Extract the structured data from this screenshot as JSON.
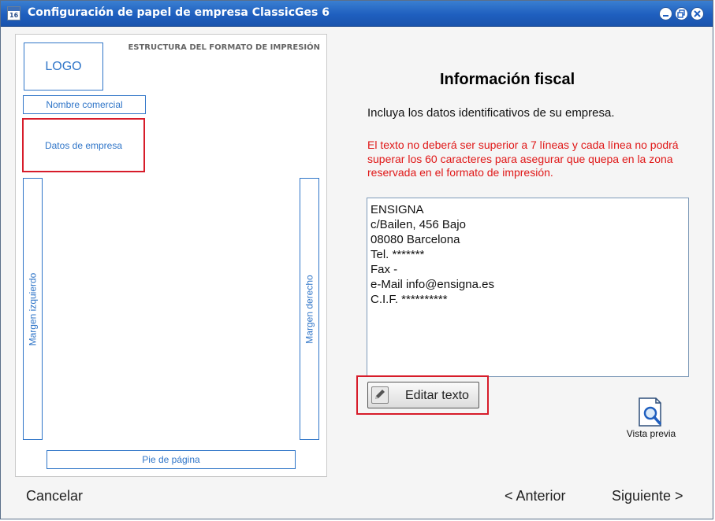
{
  "window": {
    "title": "Configuración de papel de empresa ClassicGes 6",
    "app_icon_text": "16"
  },
  "preview": {
    "structure_label": "ESTRUCTURA DEL FORMATO DE IMPRESIÓN",
    "logo": "LOGO",
    "trade_name": "Nombre comercial",
    "company_data": "Datos de empresa",
    "left_margin": "Margen izquierdo",
    "right_margin": "Margen derecho",
    "footer": "Pie de página"
  },
  "main": {
    "heading": "Información fiscal",
    "intro": "Incluya los datos identificativos de su empresa.",
    "warning": "El texto no deberá ser superior a 7 líneas y cada línea no podrá superar los 60 caracteres para asegurar que quepa en la zona reservada en el formato de impresión.",
    "fiscal_lines": [
      "ENSIGNA",
      "c/Bailen, 456 Bajo",
      "08080 Barcelona",
      "Tel. *******",
      "Fax -",
      "e-Mail info@ensigna.es",
      "C.I.F. **********"
    ],
    "edit_button": "Editar texto",
    "preview_button": "Vista previa"
  },
  "footer": {
    "cancel": "Cancelar",
    "previous": "< Anterior",
    "next": "Siguiente >"
  },
  "colors": {
    "accent_blue": "#2f75c8",
    "highlight_red": "#d71c2a",
    "warning_red": "#e01818",
    "titlebar": "#1f5fbf"
  }
}
